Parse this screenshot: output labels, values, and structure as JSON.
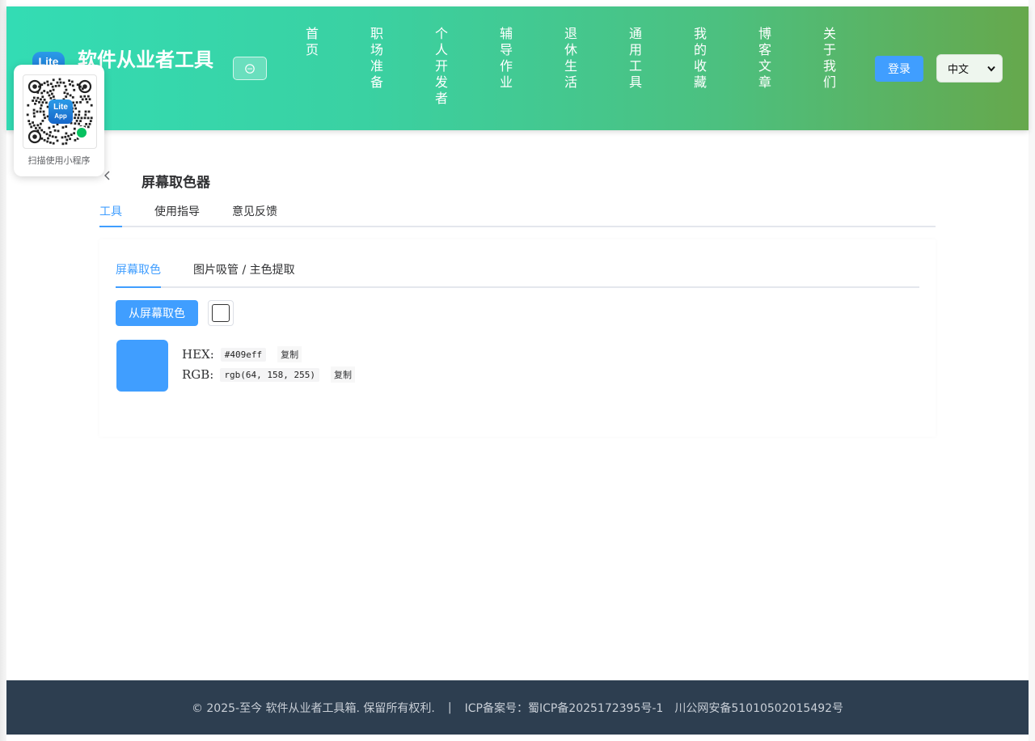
{
  "header": {
    "logo_text": "Lite",
    "site_title": "软件从业者工具",
    "nav": [
      {
        "label": "首页"
      },
      {
        "label": "职场准备"
      },
      {
        "label": "个人开发者"
      },
      {
        "label": "辅导作业"
      },
      {
        "label": "退休生活"
      },
      {
        "label": "通用工具"
      },
      {
        "label": "我的收藏"
      },
      {
        "label": "博客文章"
      },
      {
        "label": "关于我们"
      }
    ],
    "login_label": "登录",
    "language": {
      "selected": "中文"
    }
  },
  "qr_popup": {
    "badge_top": "Lite",
    "badge_bottom": "App",
    "caption": "扫描使用小程序"
  },
  "page": {
    "title": "屏幕取色器",
    "tabs": [
      {
        "label": "工具",
        "active": true
      },
      {
        "label": "使用指导",
        "active": false
      },
      {
        "label": "意见反馈",
        "active": false
      }
    ]
  },
  "tool": {
    "tabs": [
      {
        "label": "屏幕取色",
        "active": true
      },
      {
        "label": "图片吸管 / 主色提取",
        "active": false
      }
    ],
    "pick_button_label": "从屏幕取色",
    "current_color": "#409eff",
    "hex_label": "HEX:",
    "hex_value": "#409eff",
    "rgb_label": "RGB:",
    "rgb_value": "rgb(64, 158, 255)",
    "copy_label": "复制"
  },
  "footer": {
    "copyright": "© 2025-至今 软件从业者工具箱. 保留所有权利.",
    "separator": "|",
    "icp": "ICP备案号：蜀ICP备2025172395号-1",
    "police": "川公网安备51010502015492号"
  },
  "colors": {
    "accent": "#409eff",
    "header_start": "#33dcb4",
    "header_end": "#66a84c",
    "footer_bg": "#2d3e50"
  }
}
